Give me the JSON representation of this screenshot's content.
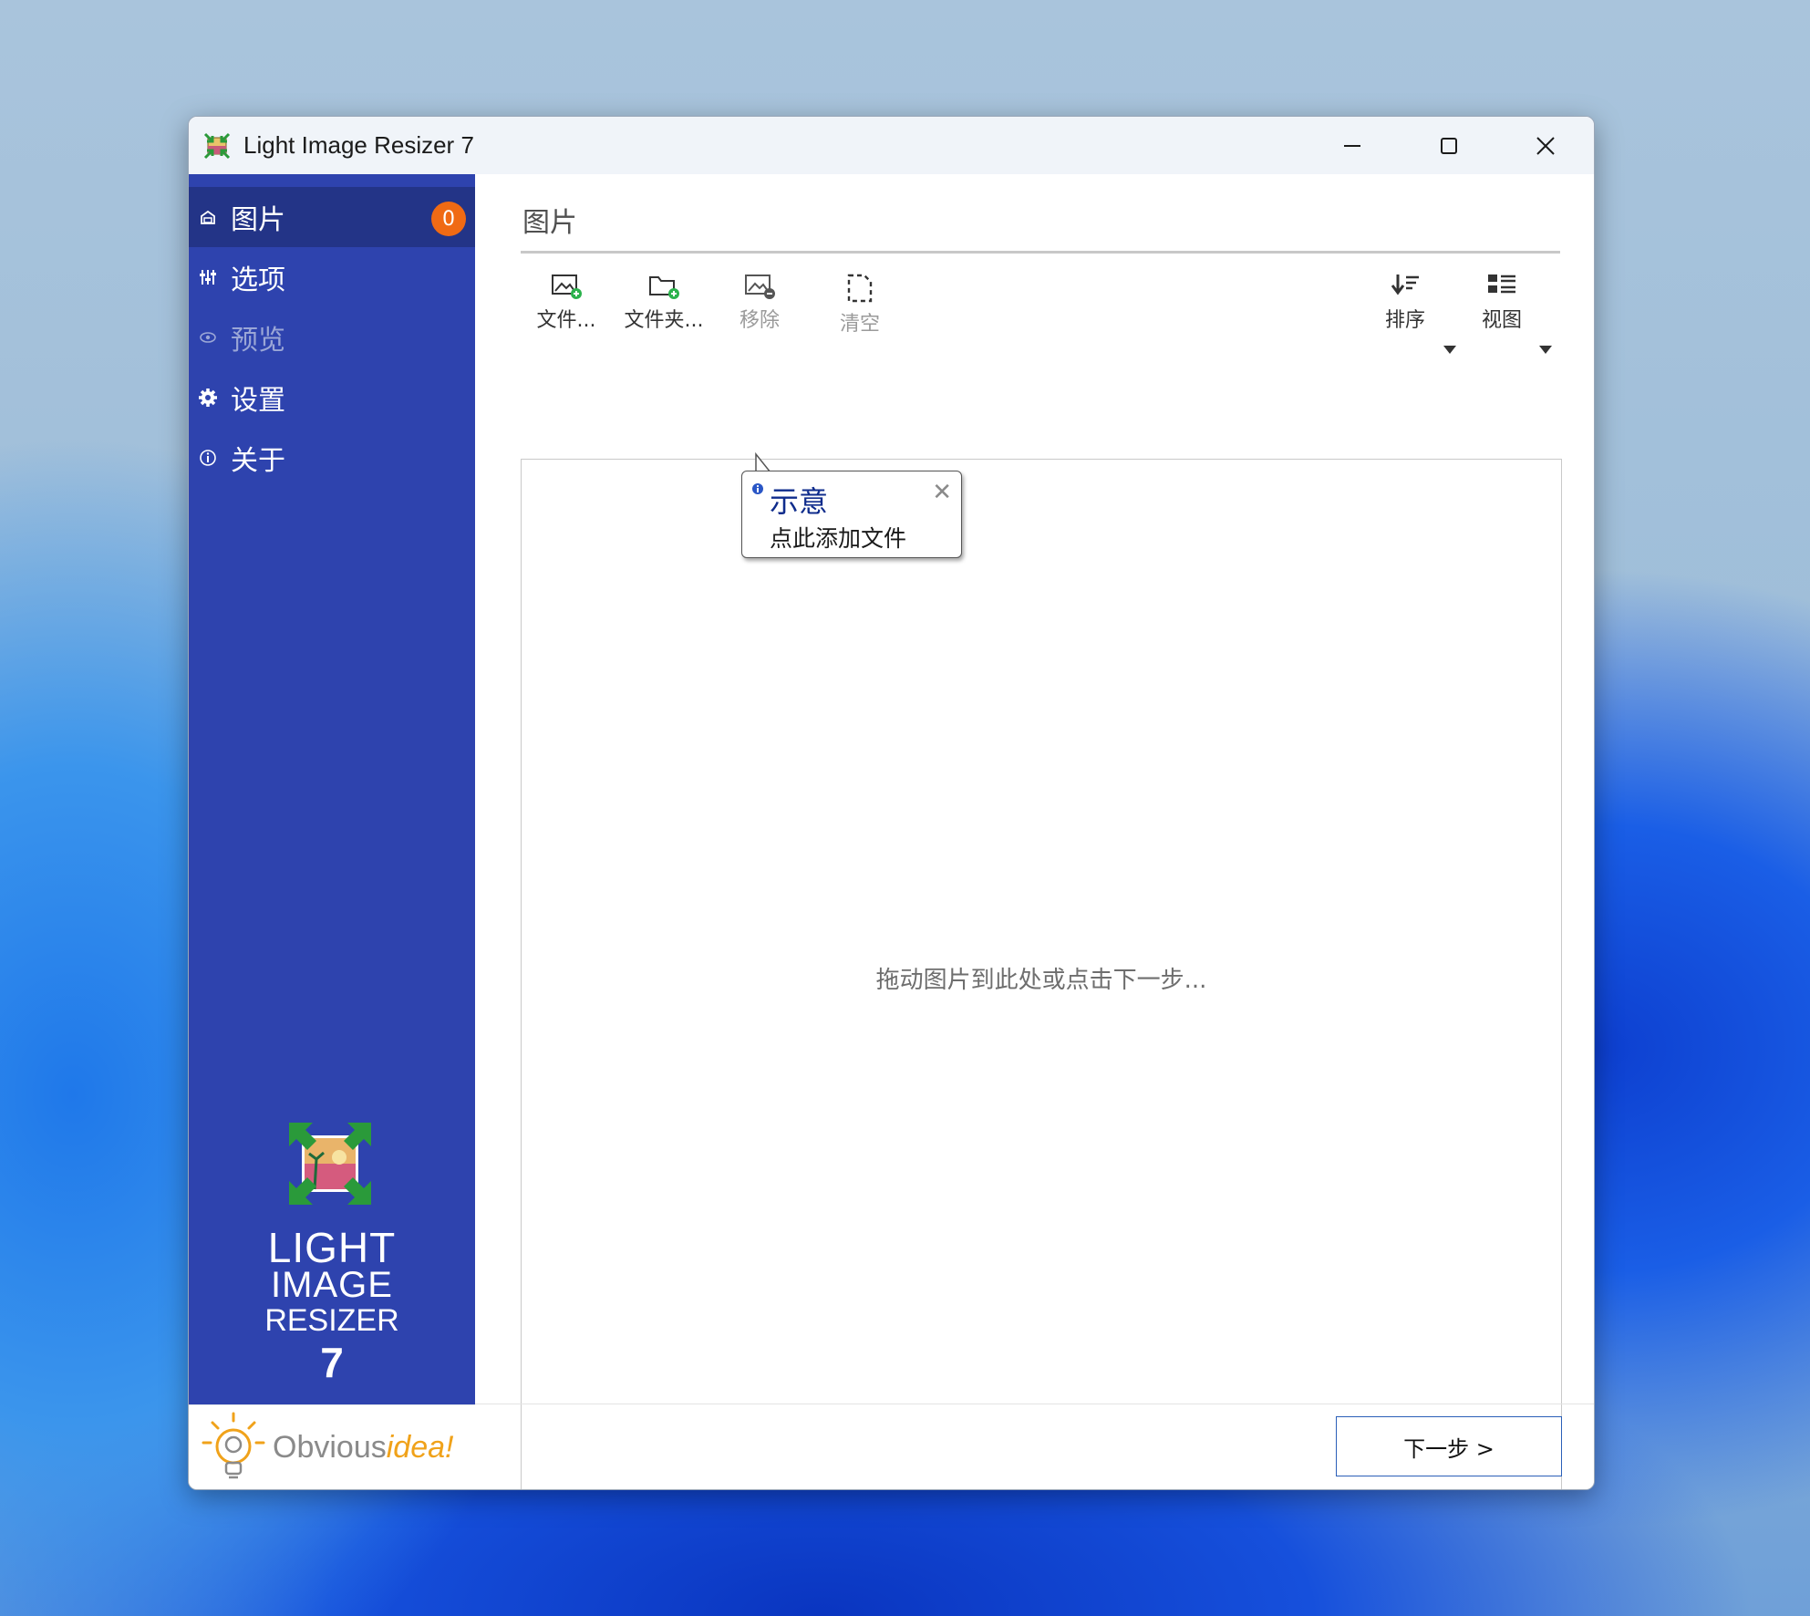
{
  "window": {
    "title": "Light Image Resizer 7"
  },
  "sidebar": {
    "items": [
      {
        "label": "图片",
        "icon": "images-icon",
        "badge": "0",
        "active": true
      },
      {
        "label": "选项",
        "icon": "sliders-icon"
      },
      {
        "label": "预览",
        "icon": "eye-icon",
        "disabled": true
      },
      {
        "label": "设置",
        "icon": "gear-icon"
      },
      {
        "label": "关于",
        "icon": "info-icon"
      }
    ],
    "brand": {
      "line1": "LIGHT",
      "line2": "IMAGE",
      "line3": "RESIZER",
      "version": "7"
    },
    "company": {
      "name_plain": "Obvious",
      "name_accent": "idea!"
    }
  },
  "main": {
    "title": "图片",
    "toolbar": {
      "files": "文件...",
      "folder": "文件夹...",
      "remove": "移除",
      "clear": "清空",
      "sort": "排序",
      "view": "视图"
    },
    "drop_hint": "拖动图片到此处或点击下一步...",
    "tooltip": {
      "title": "示意",
      "body": "点此添加文件"
    },
    "next_button": "下一步 >"
  },
  "colors": {
    "sidebar": "#2e43ae",
    "sidebar_active": "#233487",
    "badge": "#f06a14",
    "tooltip_title": "#0f2c8c",
    "next_border": "#2b5fb8"
  }
}
